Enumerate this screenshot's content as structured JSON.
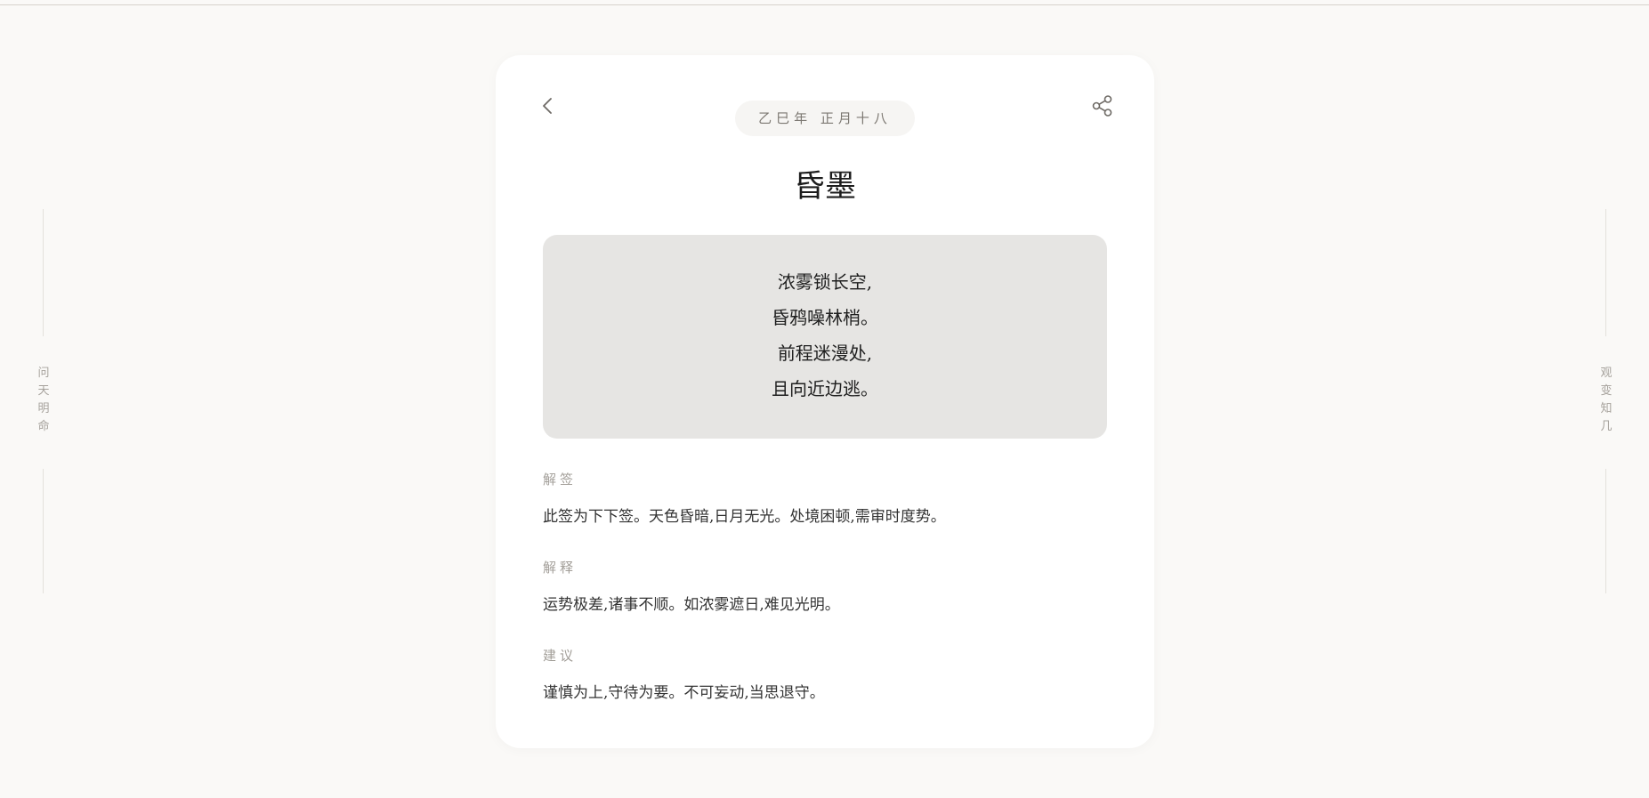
{
  "side_left": {
    "chars": [
      "问",
      "天",
      "明",
      "命"
    ]
  },
  "side_right": {
    "chars": [
      "观",
      "变",
      "知",
      "几"
    ]
  },
  "card": {
    "date": "乙巳年 正月十八",
    "title": "昏墨",
    "verse": [
      "浓雾锁长空,",
      "昏鸦噪林梢。",
      "前程迷漫处,",
      "且向近边逃。"
    ],
    "sections": [
      {
        "label": "解签",
        "text": "此签为下下签。天色昏暗,日月无光。处境困顿,需审时度势。"
      },
      {
        "label": "解释",
        "text": "运势极差,诸事不顺。如浓雾遮日,难见光明。"
      },
      {
        "label": "建议",
        "text": "谨慎为上,守待为要。不可妄动,当思退守。"
      }
    ]
  },
  "icons": {
    "back": "chevron-left-icon",
    "share": "share-icon"
  },
  "colors": {
    "background": "#faf9f7",
    "card": "#ffffff",
    "verse_bg": "#e6e5e3",
    "label": "#a29e98"
  }
}
